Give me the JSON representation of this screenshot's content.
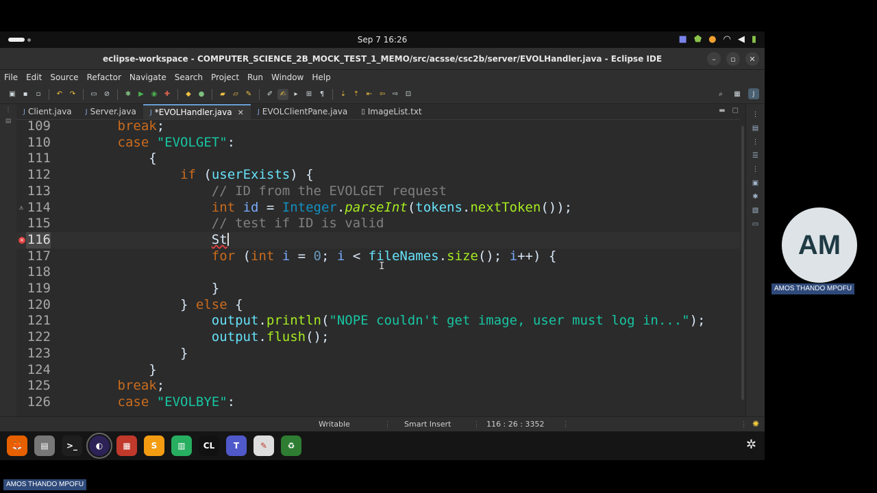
{
  "topbar": {
    "clock": "Sep 7  16:26",
    "tray_icons": [
      "teams-icon",
      "shield-icon",
      "microphone-icon",
      "wifi-icon",
      "volume-icon",
      "battery-icon"
    ]
  },
  "window": {
    "title": "eclipse-workspace - COMPUTER_SCIENCE_2B_MOCK_TEST_1_MEMO/src/acsse/csc2b/server/EVOLHandler.java - Eclipse IDE",
    "controls": [
      "–",
      "▫",
      "✕"
    ]
  },
  "menu": [
    "File",
    "Edit",
    "Source",
    "Refactor",
    "Navigate",
    "Search",
    "Project",
    "Run",
    "Window",
    "Help"
  ],
  "tabs": [
    {
      "label": "Client.java",
      "active": false
    },
    {
      "label": "Server.java",
      "active": false
    },
    {
      "label": "*EVOLHandler.java",
      "active": true
    },
    {
      "label": "EVOLClientPane.java",
      "active": false
    },
    {
      "label": "ImageList.txt",
      "active": false
    }
  ],
  "code_lines": [
    {
      "n": "109",
      "tokens": [
        [
          "        ",
          "plain"
        ],
        [
          "break",
          "kw"
        ],
        [
          ";",
          "plain"
        ]
      ]
    },
    {
      "n": "110",
      "tokens": [
        [
          "        ",
          "plain"
        ],
        [
          "case ",
          "kw"
        ],
        [
          "\"EVOLGET\"",
          "str"
        ],
        [
          ":",
          "plain"
        ]
      ]
    },
    {
      "n": "111",
      "tokens": [
        [
          "            {",
          "plain"
        ]
      ]
    },
    {
      "n": "112",
      "tokens": [
        [
          "                ",
          "plain"
        ],
        [
          "if",
          "kw"
        ],
        [
          " (",
          "plain"
        ],
        [
          "userExists",
          "fld"
        ],
        [
          ") {",
          "plain"
        ]
      ]
    },
    {
      "n": "113",
      "tokens": [
        [
          "                    ",
          "plain"
        ],
        [
          "// ID from the EVOLGET request",
          "cm"
        ]
      ]
    },
    {
      "n": "114",
      "tokens": [
        [
          "                    ",
          "plain"
        ],
        [
          "int ",
          "kw"
        ],
        [
          "id",
          "id"
        ],
        [
          " = ",
          "plain"
        ],
        [
          "Integer",
          "cls"
        ],
        [
          ".",
          "plain"
        ],
        [
          "parseInt",
          "fn"
        ],
        [
          "(",
          "plain"
        ],
        [
          "tokens",
          "fld"
        ],
        [
          ".",
          "plain"
        ],
        [
          "nextToken",
          "mth"
        ],
        [
          "());",
          "plain"
        ]
      ]
    },
    {
      "n": "115",
      "tokens": [
        [
          "                    ",
          "plain"
        ],
        [
          "// test if ID is valid",
          "cm"
        ]
      ]
    },
    {
      "n": "116",
      "tokens": [
        [
          "                    ",
          "plain"
        ],
        [
          "St",
          "err"
        ]
      ]
    },
    {
      "n": "117",
      "tokens": [
        [
          "                    ",
          "plain"
        ],
        [
          "for",
          "kw"
        ],
        [
          " (",
          "plain"
        ],
        [
          "int ",
          "kw"
        ],
        [
          "i",
          "id"
        ],
        [
          " = ",
          "plain"
        ],
        [
          "0",
          "num"
        ],
        [
          "; ",
          "plain"
        ],
        [
          "i",
          "id"
        ],
        [
          " < ",
          "plain"
        ],
        [
          "fileNames",
          "fld"
        ],
        [
          ".",
          "plain"
        ],
        [
          "size",
          "mth"
        ],
        [
          "(); ",
          "plain"
        ],
        [
          "i",
          "id"
        ],
        [
          "++) {",
          "plain"
        ]
      ]
    },
    {
      "n": "118",
      "tokens": [
        [
          "",
          "plain"
        ]
      ]
    },
    {
      "n": "119",
      "tokens": [
        [
          "                    }",
          "plain"
        ]
      ]
    },
    {
      "n": "120",
      "tokens": [
        [
          "                } ",
          "plain"
        ],
        [
          "else",
          "kw"
        ],
        [
          " {",
          "plain"
        ]
      ]
    },
    {
      "n": "121",
      "tokens": [
        [
          "                    ",
          "plain"
        ],
        [
          "output",
          "fld"
        ],
        [
          ".",
          "plain"
        ],
        [
          "println",
          "mth"
        ],
        [
          "(",
          "plain"
        ],
        [
          "\"NOPE couldn't get image, user must log in...\"",
          "str"
        ],
        [
          ");",
          "plain"
        ]
      ]
    },
    {
      "n": "122",
      "tokens": [
        [
          "                    ",
          "plain"
        ],
        [
          "output",
          "fld"
        ],
        [
          ".",
          "plain"
        ],
        [
          "flush",
          "mth"
        ],
        [
          "();",
          "plain"
        ]
      ]
    },
    {
      "n": "123",
      "tokens": [
        [
          "                }",
          "plain"
        ]
      ]
    },
    {
      "n": "124",
      "tokens": [
        [
          "            }",
          "plain"
        ]
      ]
    },
    {
      "n": "125",
      "tokens": [
        [
          "        ",
          "plain"
        ],
        [
          "break",
          "kw"
        ],
        [
          ";",
          "plain"
        ]
      ]
    },
    {
      "n": "126",
      "tokens": [
        [
          "        ",
          "plain"
        ],
        [
          "case ",
          "kw"
        ],
        [
          "\"EVOLBYE\"",
          "str"
        ],
        [
          ":",
          "plain"
        ]
      ]
    }
  ],
  "status": {
    "writable": "Writable",
    "insert_mode": "Smart Insert",
    "position": "116 : 26 : 3352"
  },
  "dock": [
    {
      "name": "firefox-icon",
      "glyph": "🦊",
      "color": "#e66000"
    },
    {
      "name": "files-icon",
      "glyph": "▤",
      "color": "#777777"
    },
    {
      "name": "terminal-icon",
      "glyph": ">_",
      "color": "#1e1e1e"
    },
    {
      "name": "eclipse-icon",
      "glyph": "◐",
      "color": "#2c2255"
    },
    {
      "name": "office-icon",
      "glyph": "▦",
      "color": "#c0392b"
    },
    {
      "name": "sublime-icon",
      "glyph": "S",
      "color": "#f39c12"
    },
    {
      "name": "spreadsheet-icon",
      "glyph": "▥",
      "color": "#27ae60"
    },
    {
      "name": "clion-icon",
      "glyph": "CL",
      "color": "#111111"
    },
    {
      "name": "teams-icon",
      "glyph": "T",
      "color": "#5059c9"
    },
    {
      "name": "text-editor-icon",
      "glyph": "✎",
      "color": "#dddddd"
    },
    {
      "name": "trash-icon",
      "glyph": "♻",
      "color": "#2e7d32"
    }
  ],
  "participant": {
    "initials": "AM",
    "name": "AMOS THANDO MPOFU"
  }
}
